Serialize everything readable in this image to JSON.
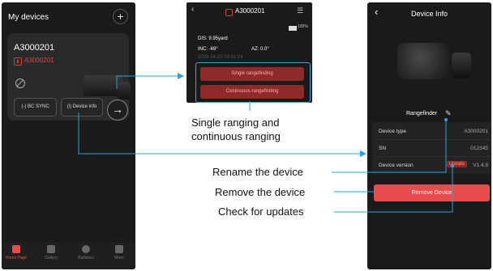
{
  "phone1": {
    "title": "My devices",
    "add_glyph": "+",
    "device_name": "A3000201",
    "device_sub": "A3000201",
    "bc_sync_label": "(-) BC SYNC",
    "device_info_label": "(i) Device info",
    "arrow_glyph": "→",
    "nav": [
      {
        "label": "Home Page",
        "icon": "home-icon",
        "active": true
      },
      {
        "label": "Gallery",
        "icon": "gallery-icon",
        "active": false
      },
      {
        "label": "Ballistics",
        "icon": "ballistics-icon",
        "active": false
      },
      {
        "label": "More",
        "icon": "more-icon",
        "active": false
      }
    ]
  },
  "phone2": {
    "back_glyph": "‹",
    "title": "A3000201",
    "menu_glyph": "☰",
    "battery": "100%",
    "dis": "DIS:  9.95yard",
    "inc": "INC:  -69°",
    "az": "AZ:  0.0°",
    "time": "2026-04-23 09:51:04",
    "single_label": "Single rangefinding",
    "continuous_label": "Continuous rangefinding"
  },
  "phone3": {
    "back_glyph": "‹",
    "title": "Device Info",
    "rangefinder_label": "Rangefinder",
    "pencil_glyph": "✎",
    "rows": [
      {
        "label": "Device type",
        "value": "A3000201"
      },
      {
        "label": "SN",
        "value": "012345"
      },
      {
        "label": "Device version",
        "value": "V1.4.9"
      }
    ],
    "update_label": "Update",
    "remove_label": "Remove Device"
  },
  "annotations": {
    "ranging_line1": "Single ranging and",
    "ranging_line2": "continuous ranging",
    "rename": "Rename the device",
    "remove": "Remove the device",
    "check": "Check for updates"
  },
  "colors": {
    "accent_red": "#e84c4c",
    "connector_blue": "#2aa3d9",
    "dark_bg": "#1a1a1a"
  }
}
